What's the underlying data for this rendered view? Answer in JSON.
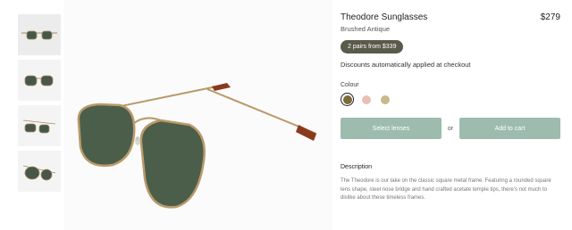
{
  "product": {
    "name": "Theodore Sunglasses",
    "price": "$279",
    "variant": "Brushed Antique",
    "promo_badge": "2 pairs from $339",
    "discount_note": "Discounts automatically applied at checkout"
  },
  "colour": {
    "label": "Colour",
    "swatches": [
      {
        "name": "brushed-antique",
        "color": "#7a6a3c",
        "selected": true
      },
      {
        "name": "rose-gold",
        "color": "#e8c0b4",
        "selected": false
      },
      {
        "name": "gold",
        "color": "#c8b98a",
        "selected": false
      }
    ]
  },
  "actions": {
    "select_lenses": "Select lenses",
    "or": "or",
    "add_to_cart": "Add to cart"
  },
  "description": {
    "heading": "Description",
    "body": "The Theodore is our take on the classic square metal frame. Featuring a rounded square lens shape, steel nose bridge and hand crafted acetate temple tips, there's not much to dislike about these timeless frames."
  },
  "gallery": {
    "prev_arrow": "‹"
  },
  "colors": {
    "button": "#9dbcae",
    "badge": "#5a5a4a",
    "lens": "#4b5e4a",
    "frame": "#b89a6a"
  }
}
